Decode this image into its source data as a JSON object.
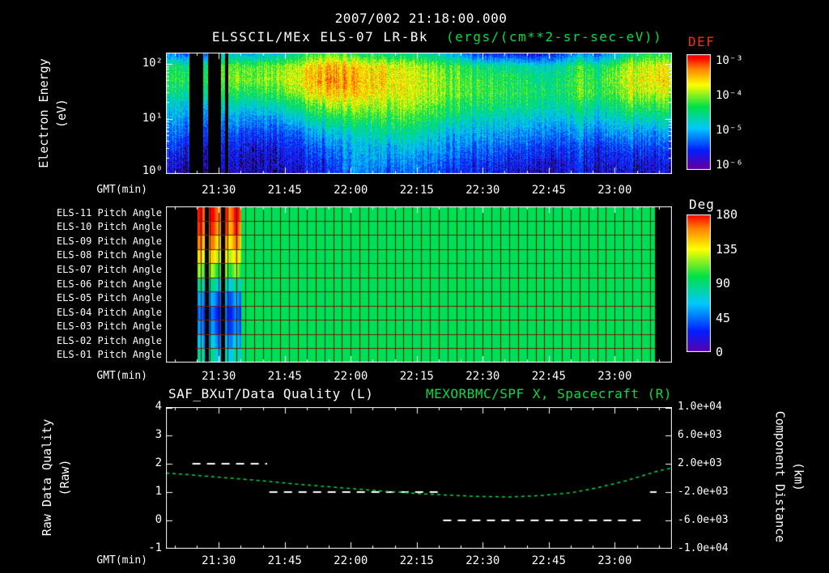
{
  "colors": {
    "background": "#000000",
    "frame": "#ffffff",
    "text": "#ffffff",
    "accent_green": "#00dd44",
    "def_title": "#ff3000",
    "row_separator": "#7a2000"
  },
  "header": {
    "timestamp": "2007/002 21:18:00.000",
    "title_left": "ELSSCIL/MEx ELS-07 LR-Bk",
    "title_units": "(ergs/(cm**2-sr-sec-eV))"
  },
  "time_axis": {
    "label": "GMT(min)",
    "start_time": "21:18",
    "tick_labels": [
      "21:30",
      "21:45",
      "22:00",
      "22:15",
      "22:30",
      "22:45",
      "23:00"
    ],
    "tick_minutes": [
      12,
      27,
      42,
      57,
      72,
      87,
      102
    ],
    "axis_start_minute": 0,
    "axis_end_minute": 115
  },
  "chart_data": [
    {
      "type": "heatmap",
      "name": "electron-energy-spectrogram",
      "ylabel_line1": "Electron Energy",
      "ylabel_line2": "(eV)",
      "y_scale": "log",
      "y_range_ev": [
        1,
        160
      ],
      "y_tick_labels": [
        "10²",
        "10¹",
        "10⁰"
      ],
      "y_tick_values": [
        100,
        10,
        1
      ],
      "value_scale": "log10 differential energy flux",
      "value_range": [
        -6.4,
        -3.5
      ],
      "colorbar": {
        "title": "DEF",
        "tick_labels": [
          "10⁻³",
          "10⁻⁴",
          "10⁻⁵",
          "10⁻⁶"
        ],
        "tick_values": [
          -3,
          -4,
          -5,
          -6
        ]
      },
      "time_bin_minutes": 4,
      "data_gaps_minutes": [
        [
          5.2,
          8.3
        ],
        [
          9.4,
          12.4
        ],
        [
          13.3,
          14.1
        ]
      ],
      "flux_log10_columns": [
        [
          -5.7,
          -4.9,
          -4.8,
          -5.0,
          -5.3,
          -5.5,
          -5.7,
          -5.9,
          -6.1,
          -6.2
        ],
        [
          -5.8,
          -4.9,
          -4.7,
          -5.0,
          -5.3,
          -5.5,
          -5.8,
          -6.0,
          -6.1,
          -6.3
        ],
        [
          -5.6,
          -4.8,
          -4.7,
          -4.9,
          -5.3,
          -5.6,
          -5.8,
          -6.0,
          -6.2,
          -6.3
        ],
        [
          -5.3,
          -4.6,
          -4.5,
          -4.8,
          -5.2,
          -5.5,
          -5.8,
          -6.0,
          -6.1,
          -6.2
        ],
        [
          -5.5,
          -4.7,
          -4.6,
          -4.9,
          -5.3,
          -5.6,
          -5.9,
          -6.1,
          -6.2,
          -6.3
        ],
        [
          -5.4,
          -4.6,
          -4.5,
          -4.8,
          -5.2,
          -5.6,
          -5.9,
          -6.1,
          -6.2,
          -6.2
        ],
        [
          -5.3,
          -4.5,
          -4.4,
          -4.7,
          -5.1,
          -5.5,
          -5.8,
          -6.0,
          -6.1,
          -6.2
        ],
        [
          -5.0,
          -4.3,
          -4.2,
          -4.4,
          -4.9,
          -5.3,
          -5.7,
          -5.9,
          -6.0,
          -6.1
        ],
        [
          -4.8,
          -4.1,
          -4.0,
          -4.2,
          -4.7,
          -5.1,
          -5.5,
          -5.8,
          -6.0,
          -6.1
        ],
        [
          -4.7,
          -4.0,
          -3.9,
          -4.1,
          -4.5,
          -5.0,
          -5.4,
          -5.7,
          -5.9,
          -6.0
        ],
        [
          -4.8,
          -4.0,
          -3.9,
          -4.0,
          -4.4,
          -4.8,
          -5.2,
          -5.4,
          -5.5,
          -5.6
        ],
        [
          -4.9,
          -4.1,
          -4.0,
          -4.1,
          -4.4,
          -4.8,
          -5.1,
          -5.3,
          -5.4,
          -5.6
        ],
        [
          -5.0,
          -4.2,
          -4.1,
          -4.2,
          -4.5,
          -4.8,
          -5.1,
          -5.4,
          -5.6,
          -5.8
        ],
        [
          -5.1,
          -4.4,
          -4.3,
          -4.3,
          -4.5,
          -4.8,
          -5.1,
          -5.4,
          -5.6,
          -5.8
        ],
        [
          -5.2,
          -4.5,
          -4.4,
          -4.4,
          -4.6,
          -4.9,
          -5.2,
          -5.5,
          -5.7,
          -5.8
        ],
        [
          -5.3,
          -4.6,
          -4.5,
          -4.5,
          -4.7,
          -5.0,
          -5.3,
          -5.5,
          -5.7,
          -5.9
        ],
        [
          -5.5,
          -4.7,
          -4.6,
          -4.6,
          -4.8,
          -5.1,
          -5.4,
          -5.6,
          -5.8,
          -6.0
        ],
        [
          -5.9,
          -4.9,
          -4.7,
          -4.7,
          -4.9,
          -5.2,
          -5.4,
          -5.7,
          -5.9,
          -6.0
        ],
        [
          -6.1,
          -5.0,
          -4.8,
          -4.7,
          -4.9,
          -5.2,
          -5.5,
          -5.7,
          -5.9,
          -6.1
        ],
        [
          -6.0,
          -5.0,
          -4.8,
          -4.8,
          -5.0,
          -5.3,
          -5.5,
          -5.8,
          -6.0,
          -6.1
        ],
        [
          -6.2,
          -5.1,
          -4.9,
          -4.8,
          -5.0,
          -5.3,
          -5.6,
          -5.8,
          -6.0,
          -6.2
        ],
        [
          -6.1,
          -5.2,
          -5.0,
          -4.9,
          -5.1,
          -5.4,
          -5.6,
          -5.9,
          -6.1,
          -6.2
        ],
        [
          -5.9,
          -5.1,
          -4.9,
          -4.9,
          -5.1,
          -5.4,
          -5.7,
          -5.9,
          -6.1,
          -6.2
        ],
        [
          -5.6,
          -4.8,
          -4.7,
          -4.7,
          -5.0,
          -5.3,
          -5.6,
          -5.9,
          -6.0,
          -6.1
        ],
        [
          -5.8,
          -5.0,
          -4.8,
          -4.8,
          -5.1,
          -5.4,
          -5.7,
          -6.0,
          -6.1,
          -6.2
        ],
        [
          -5.5,
          -4.7,
          -4.6,
          -4.7,
          -5.0,
          -5.3,
          -5.6,
          -5.9,
          -6.1,
          -6.2
        ],
        [
          -5.0,
          -4.3,
          -4.2,
          -4.3,
          -4.7,
          -5.1,
          -5.5,
          -5.8,
          -6.0,
          -6.1
        ],
        [
          -4.9,
          -4.3,
          -4.2,
          -4.4,
          -4.8,
          -5.2,
          -5.6,
          -5.9,
          -6.1,
          -6.2
        ]
      ]
    },
    {
      "type": "heatmap",
      "name": "pitch-angle-panel",
      "rows": [
        "ELS-11 Pitch Angle",
        "ELS-10 Pitch Angle",
        "ELS-09 Pitch Angle",
        "ELS-08 Pitch Angle",
        "ELS-07 Pitch Angle",
        "ELS-06 Pitch Angle",
        "ELS-05 Pitch Angle",
        "ELS-04 Pitch Angle",
        "ELS-03 Pitch Angle",
        "ELS-02 Pitch Angle",
        "ELS-01 Pitch Angle"
      ],
      "value_units": "deg",
      "value_range": [
        0,
        180
      ],
      "colorbar": {
        "title": "Deg",
        "tick_labels": [
          "180",
          "135",
          "90",
          "45",
          "0"
        ],
        "tick_values": [
          180,
          135,
          90,
          45,
          0
        ]
      },
      "data_start_minute": 7.0,
      "data_end_minute": 111,
      "base_pitch_deg": 96,
      "anomaly_minutes": [
        7.0,
        17.1
      ],
      "anomaly_gaps_minutes": [
        [
          8.8,
          9.7
        ],
        [
          12.5,
          13.4
        ]
      ],
      "anomaly_pitch_by_row": [
        172,
        165,
        152,
        135,
        112,
        78,
        48,
        35,
        42,
        58,
        75
      ],
      "grid_minutes": 2
    },
    {
      "type": "line",
      "name": "quality-and-distance",
      "left": {
        "title": "SAF_BXuT/Data Quality (L)",
        "ylabel_line1": "Raw Data Quality",
        "ylabel_line2": "(Raw)",
        "y_tick_labels": [
          "4",
          "3",
          "2",
          "1",
          "0",
          "-1"
        ],
        "y_tick_values": [
          4,
          3,
          2,
          1,
          0,
          -1
        ],
        "range": [
          -1,
          4
        ],
        "series": {
          "name": "raw-data-quality",
          "style": "dashed-white",
          "segments": [
            {
              "t0": 6,
              "t1": 23,
              "value": 2
            },
            {
              "t0": 23.5,
              "t1": 62,
              "value": 1
            },
            {
              "t0": 63,
              "t1": 109,
              "value": 0
            },
            {
              "t0": 110,
              "t1": 111.5,
              "value": 1
            }
          ]
        }
      },
      "right": {
        "title": "MEXORBMC/SPF X, Spacecraft (R)",
        "ylabel_line1": "Component Distance",
        "ylabel_line2": "(km)",
        "y_tick_labels": [
          "1.0e+04",
          "6.0e+03",
          "2.0e+03",
          "-2.0e+03",
          "-6.0e+03",
          "-1.0e+04"
        ],
        "y_tick_values": [
          10000,
          6000,
          2000,
          -2000,
          -6000,
          -10000
        ],
        "range": [
          -10000,
          10000
        ],
        "series": {
          "name": "spacecraft-x-distance",
          "style": "dashed-green",
          "points": [
            [
              0,
              700
            ],
            [
              10,
              200
            ],
            [
              20,
              -300
            ],
            [
              30,
              -900
            ],
            [
              40,
              -1400
            ],
            [
              50,
              -1900
            ],
            [
              60,
              -2300
            ],
            [
              70,
              -2600
            ],
            [
              78,
              -2700
            ],
            [
              85,
              -2500
            ],
            [
              92,
              -2100
            ],
            [
              98,
              -1400
            ],
            [
              104,
              -500
            ],
            [
              112,
              1000
            ],
            [
              115,
              1400
            ]
          ]
        }
      }
    }
  ]
}
